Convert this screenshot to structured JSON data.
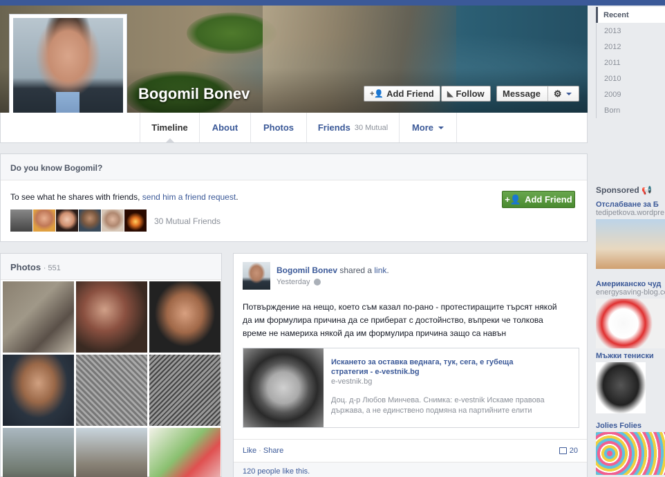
{
  "profile": {
    "name": "Bogomil Bonev"
  },
  "actions": {
    "add_friend": "Add Friend",
    "follow": "Follow",
    "message": "Message"
  },
  "nav": {
    "tabs": [
      {
        "label": "Timeline"
      },
      {
        "label": "About"
      },
      {
        "label": "Photos"
      },
      {
        "label": "Friends",
        "sub": "30 Mutual"
      },
      {
        "label": "More"
      }
    ]
  },
  "know_box": {
    "title": "Do you know Bogomil?",
    "text_prefix": "To see what he shares with friends, ",
    "link": "send him a friend request",
    "text_suffix": ".",
    "button": "Add Friend",
    "mutual": "30 Mutual Friends"
  },
  "photos_box": {
    "title": "Photos",
    "count": "· 551"
  },
  "post": {
    "author": "Bogomil Bonev",
    "action": " shared a ",
    "action_link": "link",
    "action_end": ".",
    "time": "Yesterday",
    "text": "Потвърждение на нещо, което съм казал по-рано - протестиращите търсят някой да им формулира причина да се приберат с достойнство, въпреки че толкова време не намериха някой да им формулира причина защо са навън",
    "link_card": {
      "title": "Искането за оставка веднага, тук, сега, е губеща стратегия - e-vestnik.bg",
      "domain": "e-vestnik.bg",
      "description": "Доц. д-р Любов Минчева. Снимка: e-vestnik Искаме правова държава, а не единствено подмяна на партийните елити"
    },
    "like": "Like",
    "share": "Share",
    "comments": "20",
    "likes": "120 people like this."
  },
  "timeline_years": [
    "Recent",
    "2013",
    "2012",
    "2011",
    "2010",
    "2009",
    "Born"
  ],
  "sidebar": {
    "sponsored": "Sponsored",
    "ads": [
      {
        "title": "Отслабване за Б",
        "domain": "tedipetkova.wordpre"
      },
      {
        "title": "Американско чуд",
        "domain": "energysaving-blog.co"
      },
      {
        "title": "Мъжки тениски",
        "domain": ""
      },
      {
        "title": "Jolies Folies",
        "domain": ""
      }
    ]
  },
  "colors": {
    "brand": "#3b5998",
    "green": "#4a8a2f"
  }
}
